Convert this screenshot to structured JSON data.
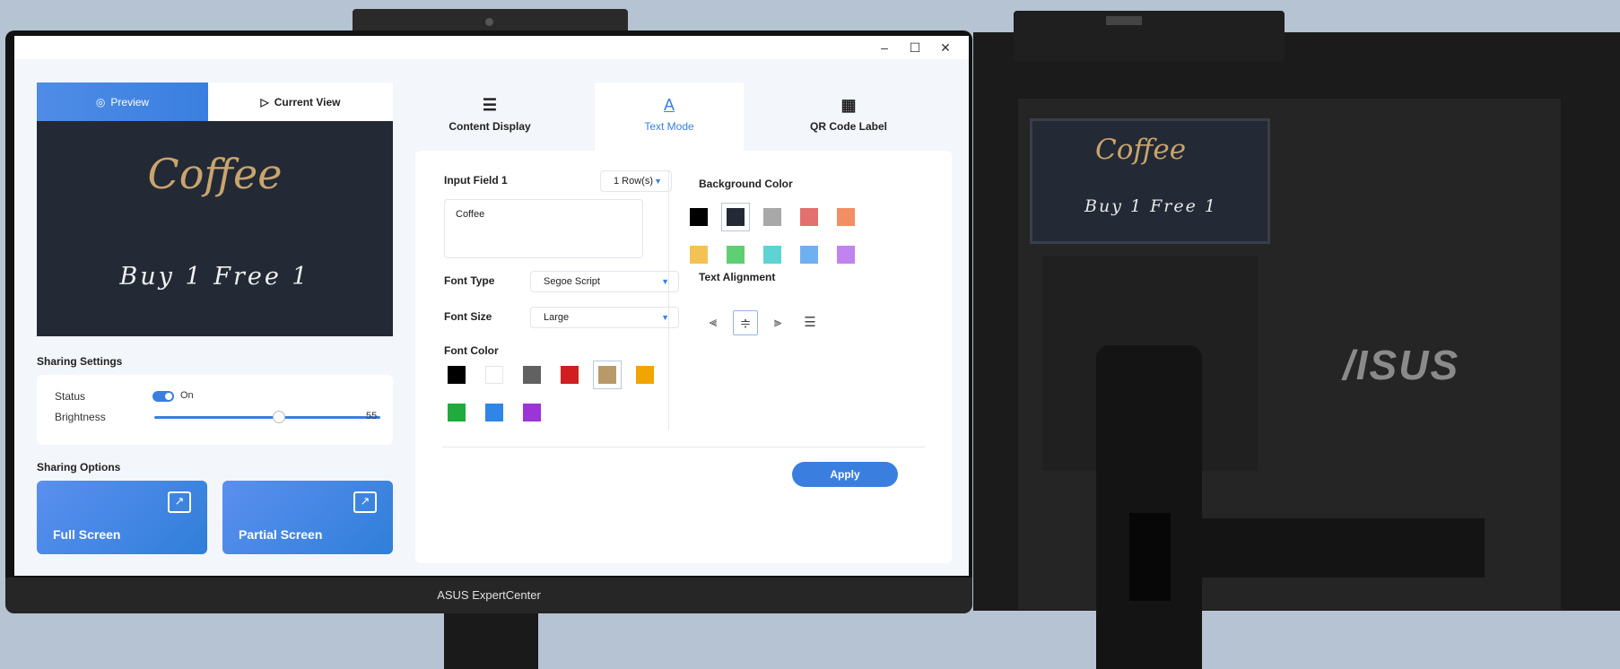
{
  "window": {
    "minimize": "–",
    "maximize": "☐",
    "close": "✕"
  },
  "view_tabs": {
    "preview": "Preview",
    "current_view": "Current View"
  },
  "preview": {
    "line1": "Coffee",
    "line2": "Buy 1 Free 1"
  },
  "sharing_settings": {
    "title": "Sharing Settings",
    "status_label": "Status",
    "status_value": "On",
    "brightness_label": "Brightness",
    "brightness_value": "55"
  },
  "sharing_options": {
    "title": "Sharing Options",
    "full_screen": "Full Screen",
    "partial_screen": "Partial Screen"
  },
  "mode_tabs": {
    "content_display": "Content Display",
    "text_mode": "Text Mode",
    "qr_code_label": "QR Code Label"
  },
  "text_mode": {
    "input_field_label": "Input Field 1",
    "rows_value": "1 Row(s)",
    "input_value": "Coffee",
    "font_type_label": "Font Type",
    "font_type_value": "Segoe Script",
    "font_size_label": "Font Size",
    "font_size_value": "Large",
    "font_color_label": "Font Color",
    "font_colors": [
      "#000000",
      "#ffffff",
      "#616161",
      "#d11f1f",
      "#b89a6a",
      "#f0a500",
      "#1fab3d",
      "#2f86e6",
      "#9b35d8"
    ],
    "font_color_selected": 4,
    "background_color_label": "Background Color",
    "background_colors": [
      "#000000",
      "#232a36",
      "#a8a8a8",
      "#e36f6f",
      "#f28e63",
      "#f4c154",
      "#5fcf74",
      "#5ed3d3",
      "#6fb0ef",
      "#c083ef"
    ],
    "background_color_selected": 1,
    "text_alignment_label": "Text Alignment",
    "alignment_selected": "center",
    "apply": "Apply"
  },
  "monitor": {
    "brand_label": "ASUS ExpertCenter",
    "rear_logo": "/ISUS"
  }
}
